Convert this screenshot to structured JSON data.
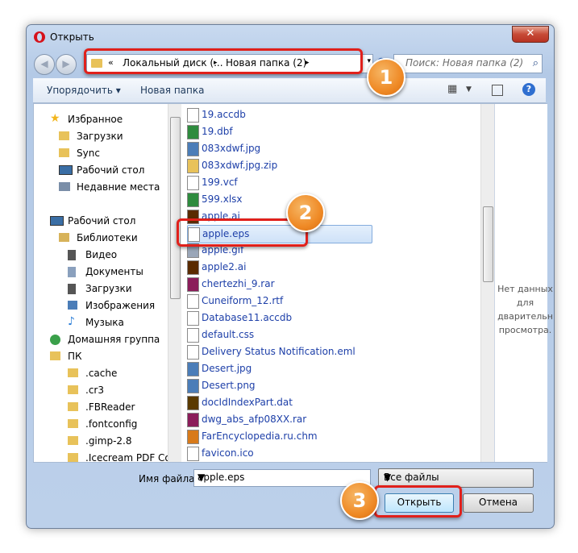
{
  "window": {
    "title": "Открыть",
    "close_glyph": "✕"
  },
  "address_bar": {
    "chevron": "«",
    "segments": [
      "Локальный диск (...",
      "Новая папка (2)"
    ],
    "separator": "▸",
    "dropdown": "▾"
  },
  "search": {
    "placeholder": "Поиск: Новая папка (2)"
  },
  "toolbar": {
    "organize": "Упорядочить ▾",
    "new_folder": "Новая папка"
  },
  "nav_pane": {
    "items": [
      {
        "label": "Избранное",
        "icon": "star-icon",
        "color": "#f2b51d"
      },
      {
        "label": "Загрузки",
        "icon": "folder-icon",
        "color": "#e8c25a"
      },
      {
        "label": "Sync",
        "icon": "folder-icon",
        "color": "#e8c25a"
      },
      {
        "label": "Рабочий стол",
        "icon": "desktop-icon",
        "color": "#3a6ea5"
      },
      {
        "label": "Недавние места",
        "icon": "recent-places-icon",
        "color": "#7a8ea8"
      },
      {
        "label": "Рабочий стол",
        "icon": "desktop-icon",
        "color": "#3a6ea5"
      },
      {
        "label": "Библиотеки",
        "icon": "library-icon",
        "color": "#d7b35a"
      },
      {
        "label": "Видео",
        "icon": "video-icon",
        "color": "#555"
      },
      {
        "label": "Документы",
        "icon": "documents-icon",
        "color": "#8aa0bd"
      },
      {
        "label": "Загрузки",
        "icon": "downloads-icon",
        "color": "#555"
      },
      {
        "label": "Изображения",
        "icon": "pictures-icon",
        "color": "#4b7db8"
      },
      {
        "label": "Музыка",
        "icon": "music-icon",
        "color": "#2d7fd8"
      },
      {
        "label": "Домашняя группа",
        "icon": "homegroup-icon",
        "color": "#3aa04a"
      },
      {
        "label": "ПК",
        "icon": "computer-icon",
        "color": "#e8c25a"
      },
      {
        "label": ".cache",
        "icon": "folder-icon",
        "color": "#e8c25a"
      },
      {
        "label": ".cr3",
        "icon": "folder-icon",
        "color": "#e8c25a"
      },
      {
        "label": ".FBReader",
        "icon": "folder-icon",
        "color": "#e8c25a"
      },
      {
        "label": ".fontconfig",
        "icon": "folder-icon",
        "color": "#e8c25a"
      },
      {
        "label": ".gimp-2.8",
        "icon": "folder-icon",
        "color": "#e8c25a"
      },
      {
        "label": ".Icecream PDF Co",
        "icon": "folder-icon",
        "color": "#e8c25a"
      }
    ]
  },
  "files": [
    {
      "name": "19.accdb",
      "icon": "file-icon"
    },
    {
      "name": "19.dbf",
      "icon": "excel-file-icon"
    },
    {
      "name": "083xdwf.jpg",
      "icon": "image-file-icon"
    },
    {
      "name": "083xdwf.jpg.zip",
      "icon": "zip-file-icon"
    },
    {
      "name": "199.vcf",
      "icon": "file-icon"
    },
    {
      "name": "599.xlsx",
      "icon": "excel-file-icon"
    },
    {
      "name": "apple.ai",
      "icon": "ai-file-icon"
    },
    {
      "name": "apple.eps",
      "icon": "eps-file-icon"
    },
    {
      "name": "apple.gif",
      "icon": "gif-file-icon"
    },
    {
      "name": "apple2.ai",
      "icon": "ai-file-icon"
    },
    {
      "name": "chertezhi_9.rar",
      "icon": "rar-file-icon"
    },
    {
      "name": "Cuneiform_12.rtf",
      "icon": "file-icon"
    },
    {
      "name": "Database11.accdb",
      "icon": "file-icon"
    },
    {
      "name": "default.css",
      "icon": "file-icon"
    },
    {
      "name": "Delivery Status Notification.eml",
      "icon": "file-icon"
    },
    {
      "name": "Desert.jpg",
      "icon": "image-file-icon"
    },
    {
      "name": "Desert.png",
      "icon": "image-file-icon"
    },
    {
      "name": "docIdIndexPart.dat",
      "icon": "dat-file-icon"
    },
    {
      "name": "dwg_abs_afp08XX.rar",
      "icon": "rar-file-icon"
    },
    {
      "name": "FarEncyclopedia.ru.chm",
      "icon": "chm-file-icon"
    },
    {
      "name": "favicon.ico",
      "icon": "file-icon"
    }
  ],
  "selected_index": 7,
  "preview": {
    "text": "Нет данных\nдля\nдварительн\nпросмотра."
  },
  "bottom": {
    "file_name_label": "Имя файла:",
    "file_name_value": "apple.eps",
    "file_type_value": "Все файлы",
    "open_label": "Открыть",
    "cancel_label": "Отмена"
  },
  "callouts": [
    "1",
    "2",
    "3"
  ],
  "colors": {
    "accent_red": "#e0201b",
    "callout_orange": "#ef8a26",
    "link_blue": "#1d3fa8"
  }
}
